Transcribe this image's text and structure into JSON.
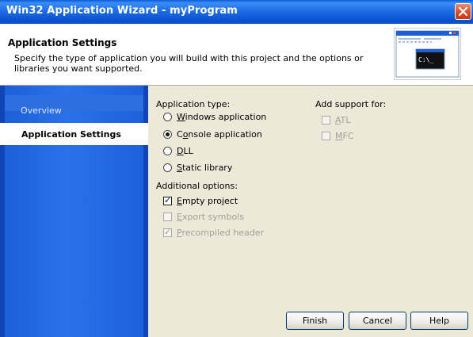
{
  "window": {
    "title": "Win32 Application Wizard - myProgram"
  },
  "header": {
    "title": "Application Settings",
    "description": "Specify the type of application you will build with this project and the options or libraries you want supported.",
    "art_prompt": "C:\\_"
  },
  "sidebar": {
    "items": [
      {
        "label": "Overview",
        "selected": false
      },
      {
        "label": "Application Settings",
        "selected": true
      }
    ]
  },
  "application_type": {
    "label": "Application type:",
    "options": [
      {
        "label": "Windows application",
        "checked": false
      },
      {
        "label": "Console application",
        "checked": true
      },
      {
        "label": "DLL",
        "checked": false
      },
      {
        "label": "Static library",
        "checked": false
      }
    ]
  },
  "additional_options": {
    "label": "Additional options:",
    "options": [
      {
        "label": "Empty project",
        "checked": true,
        "enabled": true
      },
      {
        "label": "Export symbols",
        "checked": false,
        "enabled": false
      },
      {
        "label": "Precompiled header",
        "checked": true,
        "enabled": false
      }
    ]
  },
  "add_support": {
    "label": "Add support for:",
    "options": [
      {
        "label": "ATL",
        "checked": false,
        "enabled": false
      },
      {
        "label": "MFC",
        "checked": false,
        "enabled": false
      }
    ]
  },
  "buttons": {
    "finish": "Finish",
    "cancel": "Cancel",
    "help": "Help"
  },
  "colors": {
    "titlebar": "#0a5bd9",
    "sidebar": "#1c5fd8",
    "dialog_bg": "#ece9d8",
    "close_button": "#d9481f"
  }
}
